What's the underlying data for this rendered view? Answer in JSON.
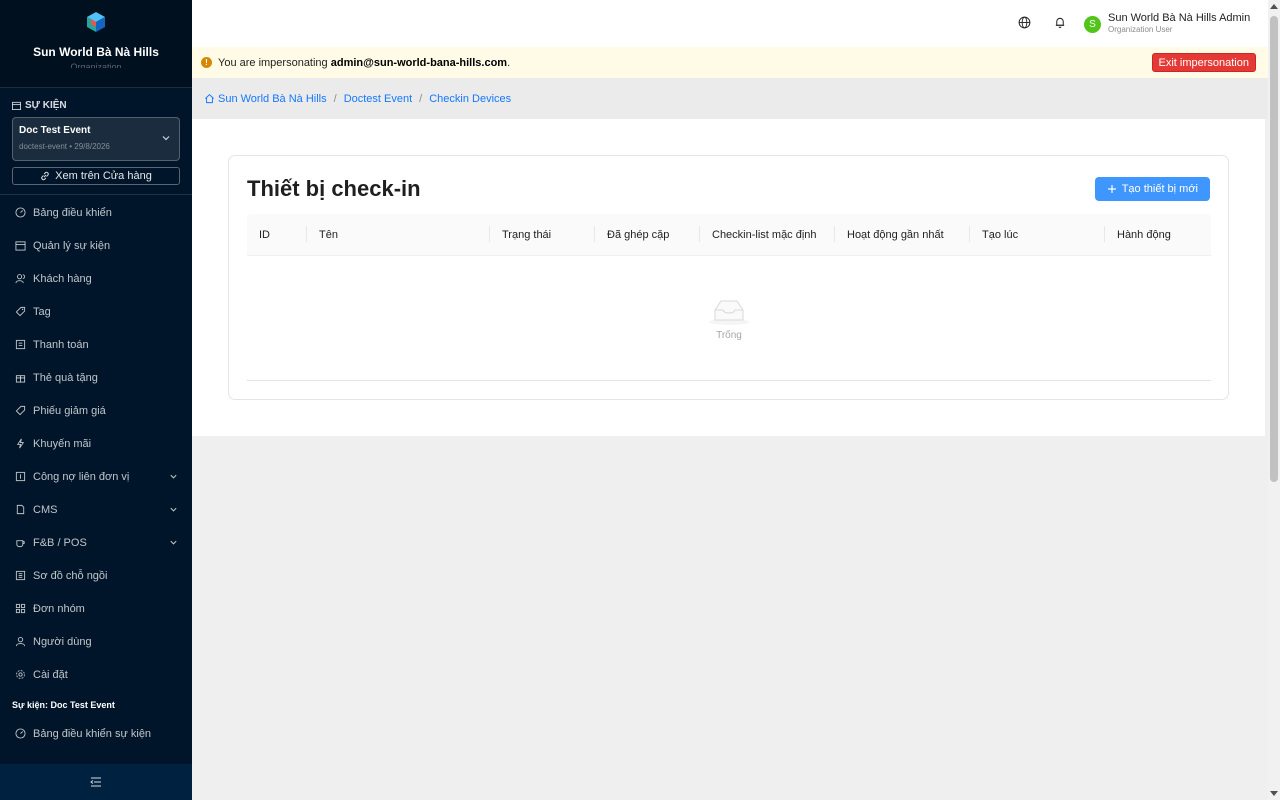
{
  "sidebar": {
    "org_name": "Sun World Bà Nà Hills",
    "org_subtitle": "Organization",
    "event_section_label": "SỰ KIỆN",
    "event": {
      "name": "Doc Test Event",
      "meta": "doctest-event • 29/8/2026"
    },
    "store_link": "Xem trên Cửa hàng",
    "items": [
      {
        "label": "Bảng điều khiển",
        "icon": "dashboard-icon"
      },
      {
        "label": "Quản lý sự kiện",
        "icon": "calendar-icon"
      },
      {
        "label": "Khách hàng",
        "icon": "users-icon"
      },
      {
        "label": "Tag",
        "icon": "tag-icon"
      },
      {
        "label": "Thanh toán",
        "icon": "payment-icon"
      },
      {
        "label": "Thẻ quà tặng",
        "icon": "gift-icon"
      },
      {
        "label": "Phiếu giảm giá",
        "icon": "coupon-icon"
      },
      {
        "label": "Khuyến mãi",
        "icon": "lightning-icon"
      },
      {
        "label": "Công nợ liên đơn vị",
        "icon": "ledger-icon"
      },
      {
        "label": "CMS",
        "icon": "file-icon"
      },
      {
        "label": "F&B / POS",
        "icon": "coffee-icon"
      },
      {
        "label": "Sơ đồ chỗ ngồi",
        "icon": "layout-icon"
      },
      {
        "label": "Đơn nhóm",
        "icon": "grid-icon"
      },
      {
        "label": "Người dùng",
        "icon": "user-icon"
      },
      {
        "label": "Cài đặt",
        "icon": "gear-icon"
      }
    ],
    "event_group_title": "Sự kiện: Doc Test Event",
    "event_items": [
      {
        "label": "Bảng điều khiển sự kiện",
        "icon": "dashboard-icon"
      }
    ]
  },
  "header": {
    "user_initial": "S",
    "user_name": "Sun World Bà Nà Hills Admin",
    "user_role": "Organization User"
  },
  "impersonation": {
    "prefix": "You are impersonating ",
    "email": "admin@sun-world-bana-hills.com",
    "suffix": ".",
    "exit_label": "Exit impersonation"
  },
  "breadcrumb": [
    "Sun World Bà Nà Hills",
    "Doctest Event",
    "Checkin Devices"
  ],
  "page": {
    "title": "Thiết bị check-in",
    "create_label": "Tạo thiết bị mới",
    "columns": [
      "ID",
      "Tên",
      "Trạng thái",
      "Đã ghép cặp",
      "Checkin-list mặc định",
      "Hoạt động gần nhất",
      "Tạo lúc",
      "Hành động"
    ],
    "empty_text": "Trống"
  },
  "colors": {
    "sidebar_bg": "#001529",
    "primary": "#1677ff",
    "button_blue": "#4096ff",
    "danger": "#e53935",
    "warning_bg": "#fffbe6",
    "avatar": "#52c41a"
  }
}
